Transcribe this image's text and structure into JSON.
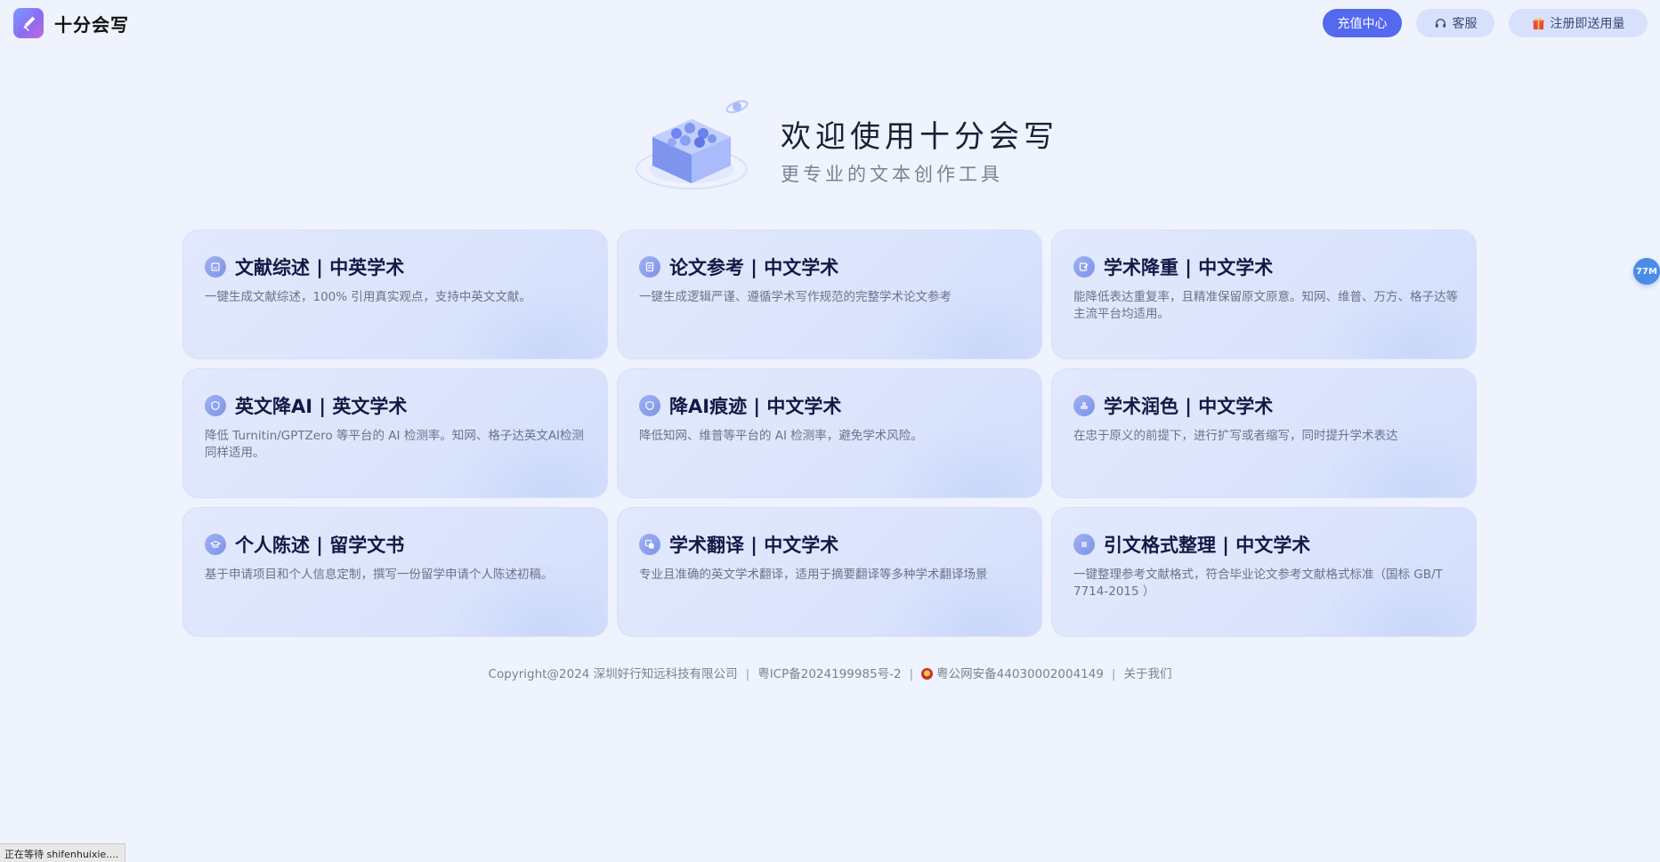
{
  "header": {
    "brand_name": "十分会写",
    "recharge_label": "充值中心",
    "service_label": "客服",
    "register_label": "注册即送用量"
  },
  "hero": {
    "title": "欢迎使用十分会写",
    "subtitle": "更专业的文本创作工具"
  },
  "cards": [
    {
      "title": "文献综述 | 中英学术",
      "desc": "一键生成文献综述，100% 引用真实观点，支持中英文文献。",
      "icon": "book-icon"
    },
    {
      "title": "论文参考 | 中文学术",
      "desc": "一键生成逻辑严谨、遵循学术写作规范的完整学术论文参考",
      "icon": "document-icon"
    },
    {
      "title": "学术降重 | 中文学术",
      "desc": "能降低表达重复率，且精准保留原文原意。知网、维普、万方、格子达等主流平台均适用。",
      "icon": "edit-icon"
    },
    {
      "title": "英文降AI | 英文学术",
      "desc": "降低 Turnitin/GPTZero 等平台的 AI 检测率。知网、格子达英文AI检测同样适用。",
      "icon": "shield-icon"
    },
    {
      "title": "降AI痕迹 | 中文学术",
      "desc": "降低知网、维普等平台的 AI 检测率，避免学术风险。",
      "icon": "shield-icon"
    },
    {
      "title": "学术润色 | 中文学术",
      "desc": "在忠于原义的前提下，进行扩写或者缩写，同时提升学术表达",
      "icon": "brush-icon"
    },
    {
      "title": "个人陈述 | 留学文书",
      "desc": "基于申请项目和个人信息定制，撰写一份留学申请个人陈述初稿。",
      "icon": "graduation-cap-icon"
    },
    {
      "title": "学术翻译 | 中文学术",
      "desc": "专业且准确的英文学术翻译，适用于摘要翻译等多种学术翻译场景",
      "icon": "translate-icon"
    },
    {
      "title": "引文格式整理 | 中文学术",
      "desc": "一键整理参考文献格式，符合毕业论文参考文献格式标准（国标 GB/T 7714-2015 ）",
      "icon": "list-icon"
    }
  ],
  "footer": {
    "copyright": "Copyright@2024 深圳好行知远科技有限公司",
    "icp": "粤ICP备2024199985号-2",
    "police": "粤公网安备44030002004149",
    "about": "关于我们",
    "separator": "|"
  },
  "float_badge": "77M",
  "status_bar": "正在等待 shifenhuixie...."
}
